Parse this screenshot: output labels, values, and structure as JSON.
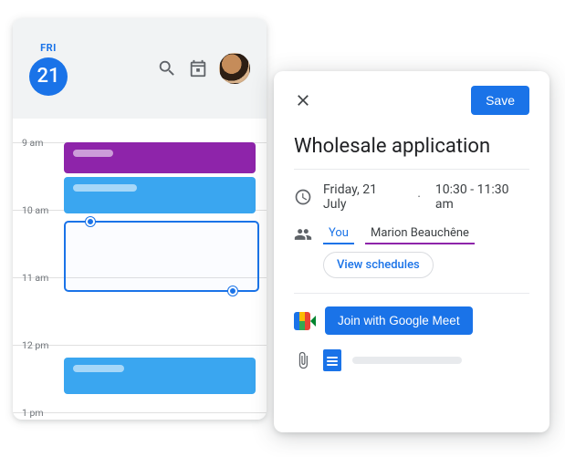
{
  "calendar": {
    "day_abbr": "FRI",
    "day_num": "21",
    "hours": {
      "h9": "9 am",
      "h10": "10 am",
      "h11": "11 am",
      "h12": "12 pm",
      "h1": "1 pm"
    }
  },
  "panel": {
    "save_label": "Save",
    "title": "Wholesale application",
    "date": "Friday, 21 July",
    "time": "10:30 - 11:30 am",
    "guest_you": "You",
    "guest_marion": "Marion Beauchêne",
    "view_schedules": "View schedules",
    "meet_label": "Join with Google Meet"
  }
}
